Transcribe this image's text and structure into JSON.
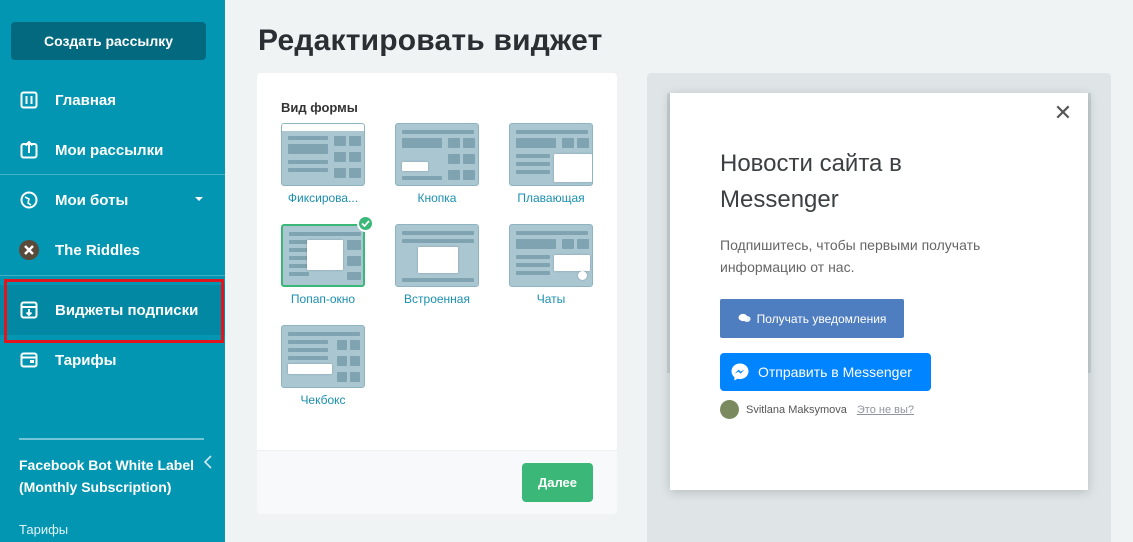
{
  "sidebar": {
    "create_label": "Создать рассылку",
    "items": [
      {
        "label": "Главная",
        "icon": "dashboard-icon"
      },
      {
        "label": "Мои рассылки",
        "icon": "upload-icon"
      },
      {
        "label": "Мои боты",
        "icon": "globe-icon"
      },
      {
        "label": "The Riddles",
        "icon": "avatar"
      },
      {
        "label": "Виджеты подписки",
        "icon": "widget-icon"
      },
      {
        "label": "Тарифы",
        "icon": "wallet-icon"
      }
    ],
    "plan_name": "Facebook Bot White Label (Monthly Subscription)",
    "plan_sub": "Тарифы"
  },
  "main": {
    "title": "Редактировать виджет",
    "form_label": "Вид формы",
    "options": [
      {
        "label": "Фиксирова..."
      },
      {
        "label": "Кнопка"
      },
      {
        "label": "Плавающая"
      },
      {
        "label": "Попап-окно"
      },
      {
        "label": "Встроенная"
      },
      {
        "label": "Чаты"
      },
      {
        "label": "Чекбокс"
      }
    ],
    "next_label": "Далее"
  },
  "preview": {
    "close": "✕",
    "title": "Новости сайта в Messenger",
    "description": "Подпишитесь, чтобы первыми получать информацию от нас.",
    "notify_label": "Получать уведомления",
    "messenger_label": "Отправить в Messenger",
    "user_name": "Svitlana Maksymova",
    "not_you": "Это не вы?"
  },
  "colors": {
    "sidebar": "#0396b2",
    "accent_green": "#3bb878",
    "messenger_blue": "#0084ff",
    "highlight_red": "#e0161e"
  }
}
